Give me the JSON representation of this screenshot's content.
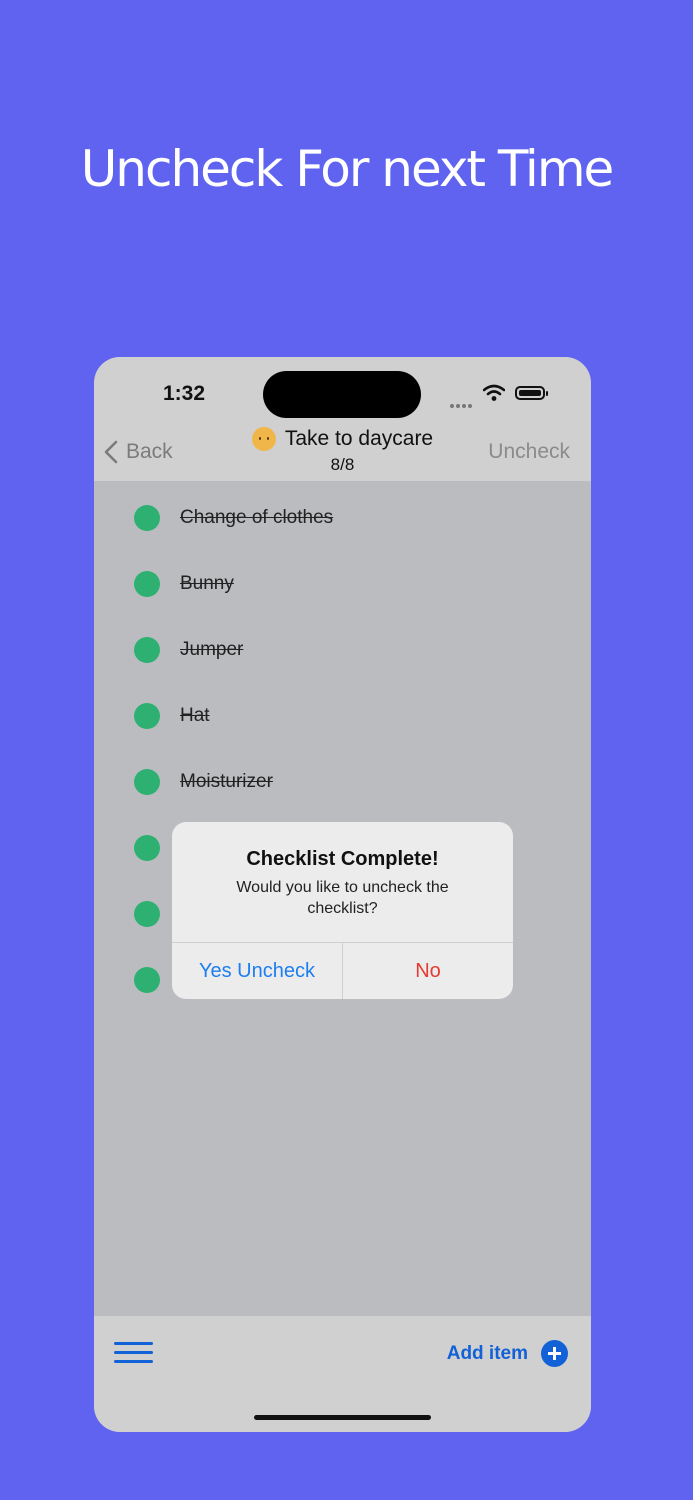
{
  "headline": "Uncheck For next Time",
  "status_bar": {
    "time": "1:32"
  },
  "nav": {
    "back_label": "Back",
    "title": "Take to daycare",
    "count": "8/8",
    "uncheck_label": "Uncheck"
  },
  "items": [
    {
      "label": "Change of clothes"
    },
    {
      "label": "Bunny"
    },
    {
      "label": "Jumper"
    },
    {
      "label": "Hat"
    },
    {
      "label": "Moisturizer"
    },
    {
      "label": ""
    },
    {
      "label": ""
    },
    {
      "label": ""
    }
  ],
  "alert": {
    "title": "Checklist Complete!",
    "message": "Would you like to uncheck the checklist?",
    "yes_label": "Yes Uncheck",
    "no_label": "No"
  },
  "bottom": {
    "add_label": "Add item"
  },
  "colors": {
    "background": "#5f63f0",
    "checked": "#2fb073",
    "accent": "#1361d6",
    "destructive": "#e53b30"
  }
}
